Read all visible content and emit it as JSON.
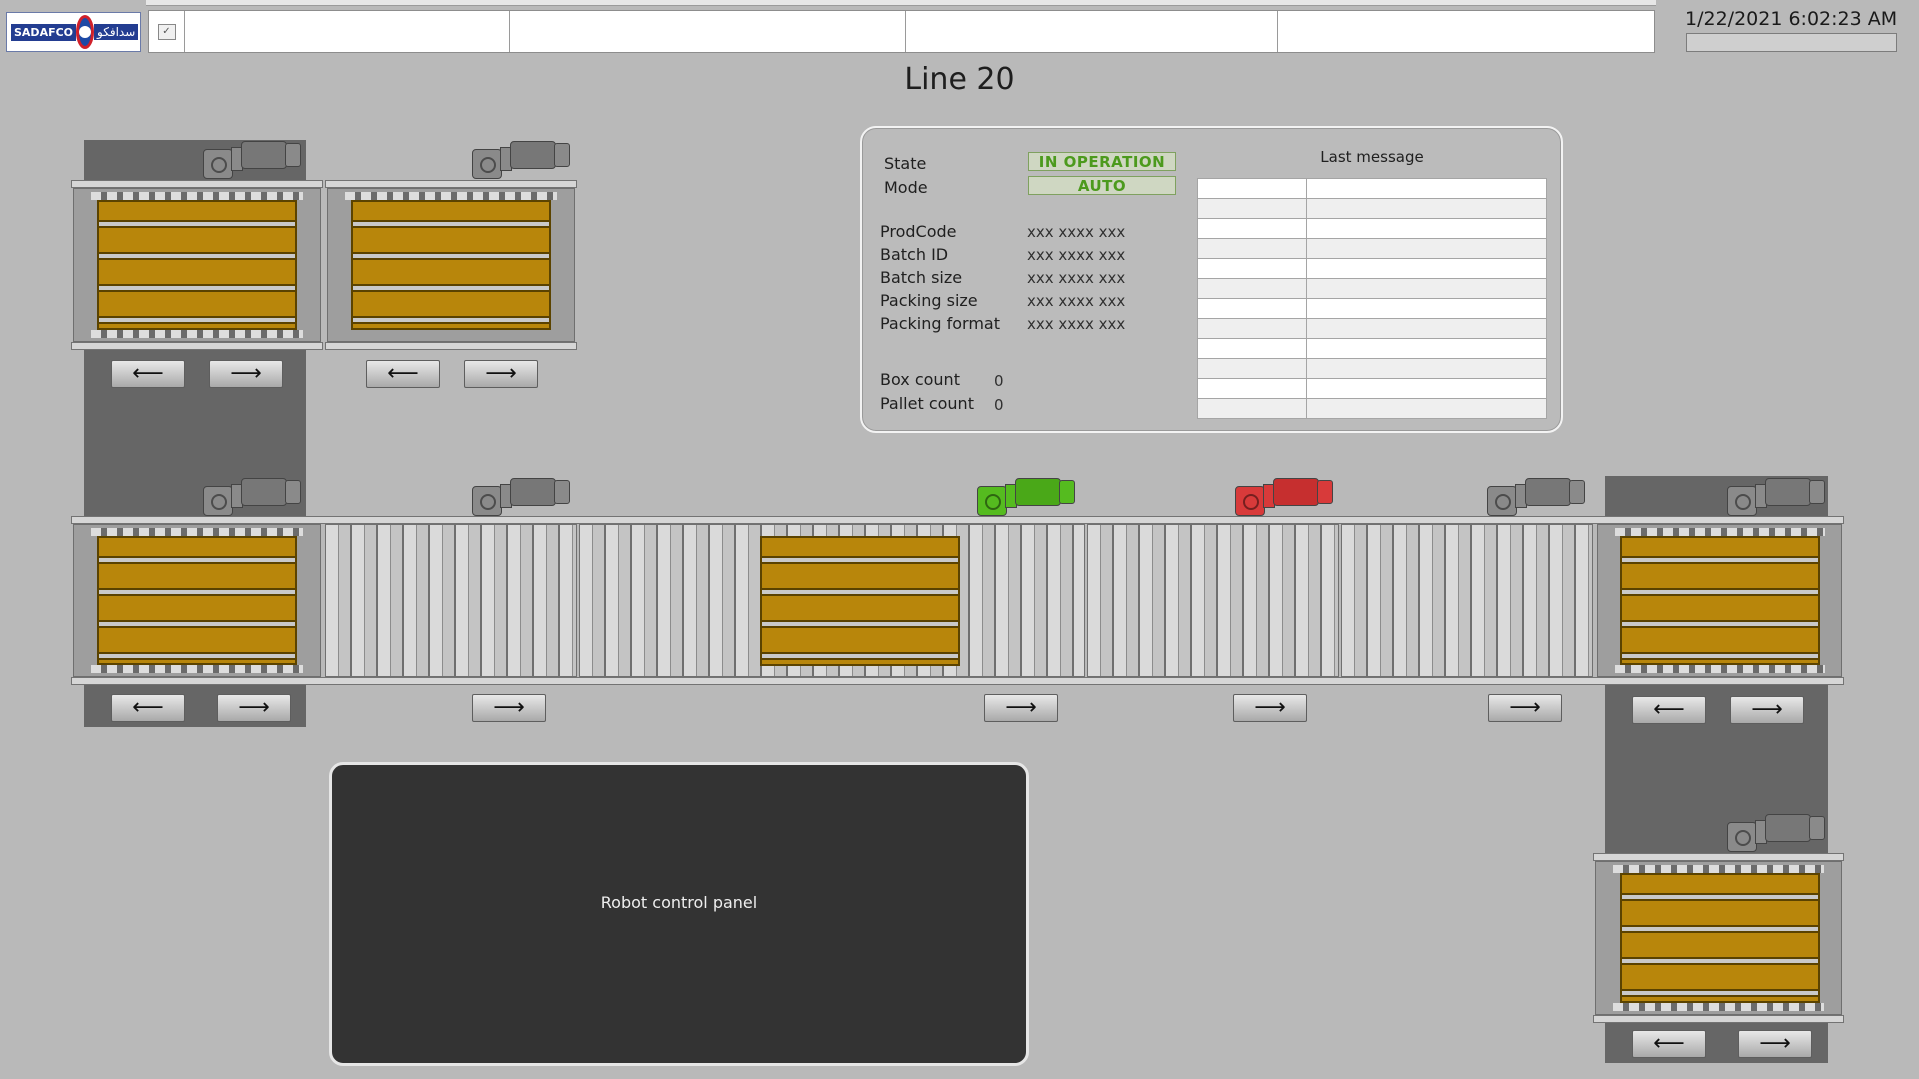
{
  "header": {
    "logo_text_en": "SADAFCO",
    "logo_text_ar": "سدافكو",
    "datetime": "1/22/2021 6:02:23 AM"
  },
  "page": {
    "title": "Line 20"
  },
  "info": {
    "state_label": "State",
    "state_value": "IN OPERATION",
    "mode_label": "Mode",
    "mode_value": "AUTO",
    "fields": [
      {
        "label": "ProdCode",
        "value": "xxx xxxx xxx"
      },
      {
        "label": "Batch ID",
        "value": "xxx xxxx xxx"
      },
      {
        "label": "Batch size",
        "value": "xxx xxxx xxx"
      },
      {
        "label": "Packing size",
        "value": "xxx xxxx xxx"
      },
      {
        "label": "Packing format",
        "value": "xxx xxxx xxx"
      }
    ],
    "box_count_label": "Box count",
    "box_count": "0",
    "pallet_count_label": "Pallet count",
    "pallet_count": "0",
    "last_message_label": "Last message"
  },
  "controls": {
    "arrow_left": "⟵",
    "arrow_right": "⟶"
  },
  "motors": {
    "colors": {
      "idle": "#8a8a8a",
      "running": "#55bb1f",
      "fault": "#d83a3a"
    }
  },
  "robot_panel": {
    "label": "Robot control panel"
  }
}
